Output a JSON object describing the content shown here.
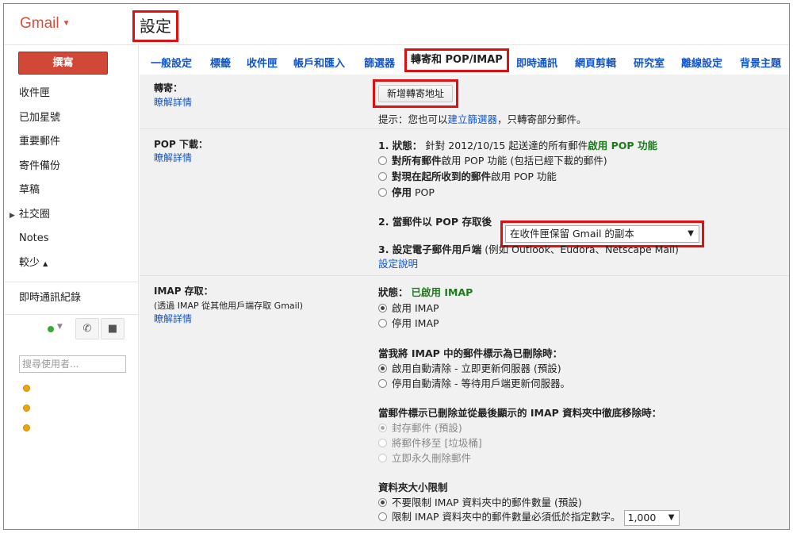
{
  "app": {
    "logo": "Gmail",
    "page_title": "設定"
  },
  "sidebar": {
    "compose_label": "撰寫",
    "items": [
      "收件匣",
      "已加星號",
      "重要郵件",
      "寄件備份",
      "草稿",
      "社交圈",
      "Notes",
      "較少"
    ],
    "less_caret": "▲",
    "chat_log": "即時通訊紀錄",
    "search_placeholder": "搜尋使用者..."
  },
  "tabs": [
    "一般設定",
    "標籤",
    "收件匣",
    "帳戶和匯入",
    "篩選器",
    "轉寄和 POP/IMAP",
    "即時通訊",
    "網頁剪輯",
    "研究室",
    "離線設定",
    "背景主題"
  ],
  "forwarding": {
    "label": "轉寄：",
    "learn_more": "瞭解詳情",
    "add_button": "新增轉寄地址",
    "tip_prefix": "提示：您也可以",
    "tip_link": "建立篩選器",
    "tip_suffix": "，只轉寄部分郵件。"
  },
  "pop": {
    "label": "POP 下載：",
    "learn_more": "瞭解詳情",
    "status_label": "1. 狀態：",
    "status_text": "針對 2012/10/15 起送達的所有郵件",
    "status_value": "啟用 POP 功能",
    "opt1_bold": "對所有郵件",
    "opt1_rest": "啟用 POP 功能 (包括已經下載的郵件)",
    "opt2_bold": "對現在起所收到的郵件",
    "opt2_rest": "啟用 POP 功能",
    "opt3": "停用",
    "opt3_rest": "POP",
    "q2_label": "2. 當郵件以 POP 存取後",
    "q2_select": "在收件匣保留 Gmail 的副本",
    "q3_label": "3. 設定電子郵件用戶端",
    "q3_rest": "(例如 Outlook、Eudora、Netscape Mail)",
    "q3_link": "設定說明"
  },
  "imap": {
    "label": "IMAP 存取：",
    "sub": "(透過 IMAP 從其他用戶端存取 Gmail)",
    "learn_more": "瞭解詳情",
    "status_label": "狀態：",
    "status_value": "已啟用 IMAP",
    "enable": "啟用 IMAP",
    "disable": "停用 IMAP",
    "delete_heading": "當我將 IMAP 中的郵件標示為已刪除時：",
    "delete_opt1": "啟用自動清除 - 立即更新伺服器 (預設)",
    "delete_opt2": "停用自動清除 - 等待用戶端更新伺服器。",
    "expunge_heading": "當郵件標示已刪除並從最後顯示的 IMAP 資料夾中徹底移除時：",
    "expunge_opt1": "封存郵件 (預設)",
    "expunge_opt2": "將郵件移至 [垃圾桶]",
    "expunge_opt3": "立即永久刪除郵件",
    "size_heading": "資料夾大小限制",
    "size_opt1": "不要限制 IMAP 資料夾中的郵件數量 (預設)",
    "size_opt2": "限制 IMAP 資料夾中的郵件數量必須低於指定數字。",
    "size_select": "1,000"
  },
  "colors": {
    "brand_red": "#dd4b39",
    "compose_red": "#d14836",
    "link_blue": "#1155cc",
    "highlight_red": "#dd1111",
    "status_green": "#1c7b1c"
  }
}
